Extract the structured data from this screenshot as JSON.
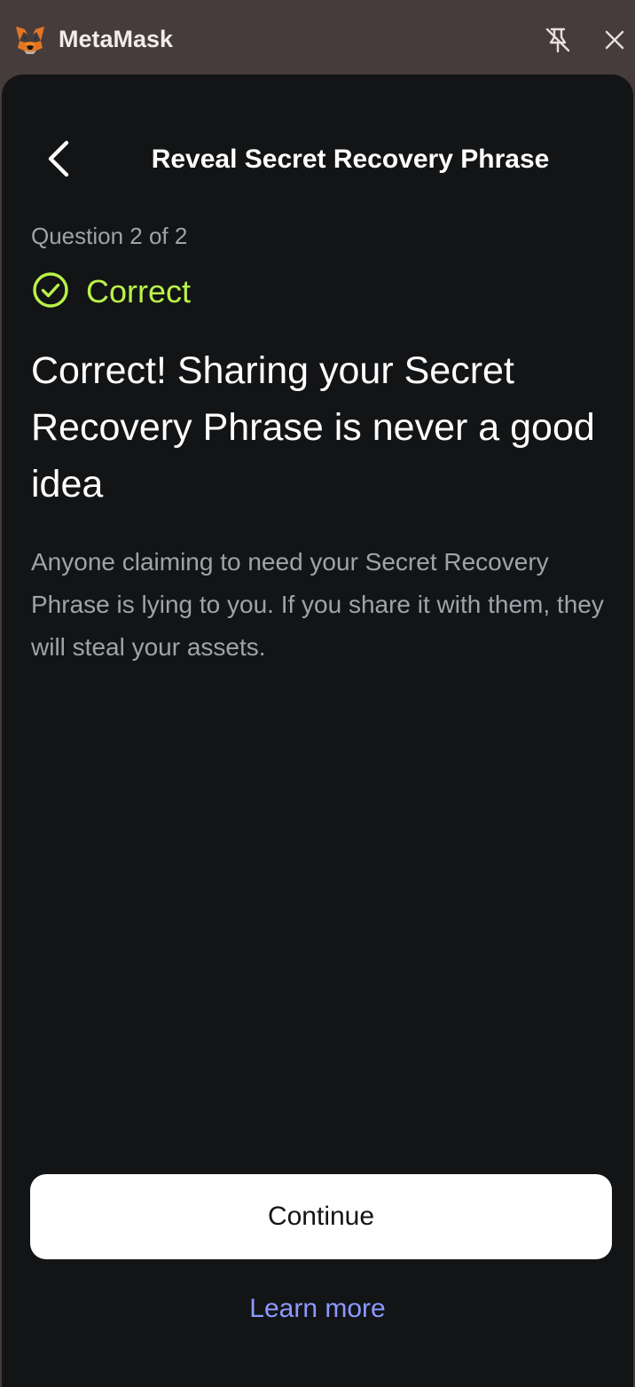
{
  "window": {
    "app_name": "MetaMask",
    "icons": {
      "app": "metamask-fox-icon",
      "pin": "unpin-icon",
      "close": "close-icon"
    }
  },
  "header": {
    "title": "Reveal Secret Recovery Phrase",
    "back_icon": "chevron-left-icon"
  },
  "quiz": {
    "counter": "Question 2 of 2",
    "status_label": "Correct",
    "status_icon": "check-circle-icon",
    "headline": "Correct! Sharing your Secret Recovery Phrase is never a good idea",
    "body": "Anyone claiming to need your Secret Recovery Phrase is lying to you. If you share it with them, they will steal your assets."
  },
  "actions": {
    "continue_label": "Continue",
    "learn_more_label": "Learn more"
  },
  "colors": {
    "background": "#131416",
    "window_bar": "#473c3c",
    "success": "#baf24a",
    "link": "#8b99ff",
    "muted_text": "#9fa3aa"
  }
}
